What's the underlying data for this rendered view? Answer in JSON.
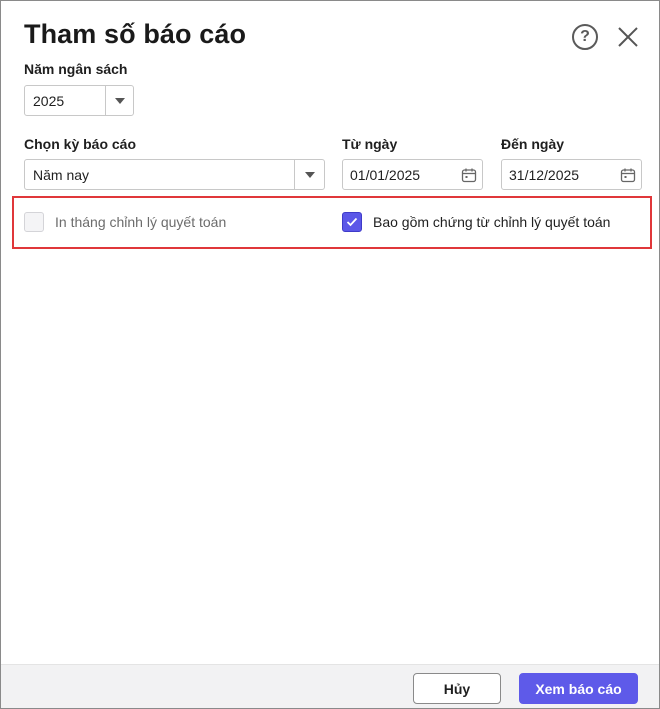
{
  "dialog": {
    "title": "Tham số báo cáo",
    "help_icon": "question-circle-icon",
    "close_icon": "close-icon"
  },
  "budget_year": {
    "label": "Năm ngân sách",
    "value": "2025"
  },
  "period": {
    "label": "Chọn kỳ báo cáo",
    "value": "Năm nay"
  },
  "from_date": {
    "label": "Từ ngày",
    "value": "01/01/2025"
  },
  "to_date": {
    "label": "Đến ngày",
    "value": "31/12/2025"
  },
  "options": {
    "print_adjust_month": {
      "label": "In tháng chỉnh lý quyết toán",
      "checked": false,
      "disabled": true
    },
    "include_adjust_vouchers": {
      "label": "Bao gồm chứng từ chỉnh lý quyết toán",
      "checked": true,
      "disabled": false
    }
  },
  "footer": {
    "cancel_label": "Hủy",
    "view_label": "Xem báo cáo"
  },
  "colors": {
    "primary": "#5e5ae9",
    "highlight_border": "#e0373a",
    "footer_bg": "#f2f2f3"
  }
}
